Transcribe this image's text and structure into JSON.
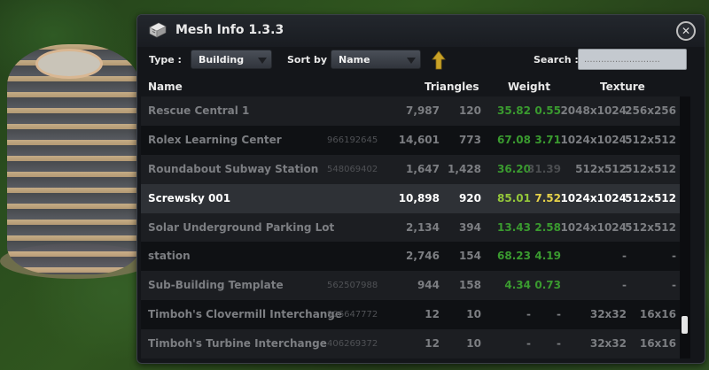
{
  "window": {
    "title": "Mesh Info 1.3.3",
    "close_glyph": "✕",
    "icon": "mesh-info-app-icon"
  },
  "toolbar": {
    "type_label": "Type :",
    "type_value": "Building",
    "sort_label": "Sort by :",
    "sort_value": "Name",
    "sort_direction_icon": "arrow-up-icon",
    "search_label": "Search :",
    "search_value": "",
    "search_placeholder": "..........................."
  },
  "columns": {
    "name": "Name",
    "triangles": "Triangles",
    "weight": "Weight",
    "texture": "Texture"
  },
  "rows": [
    {
      "name": "Rescue Central 1",
      "id": "",
      "triangles": "7,987",
      "lod_triangles": "120",
      "weight": "35.82",
      "lod_weight": "0.55",
      "texture": "2048x1024",
      "lod_texture": "256x256"
    },
    {
      "name": "Rolex Learning Center",
      "id": "966192645",
      "triangles": "14,601",
      "lod_triangles": "773",
      "weight": "67.08",
      "lod_weight": "3.71",
      "texture": "1024x1024",
      "lod_texture": "512x512"
    },
    {
      "name": "Roundabout Subway Station",
      "id": "548069402",
      "triangles": "1,647",
      "lod_triangles": "1,428",
      "weight": "36.20",
      "lod_weight": "31.39",
      "texture": "512x512",
      "lod_texture": "512x512"
    },
    {
      "name": "Screwsky 001",
      "id": "",
      "triangles": "10,898",
      "lod_triangles": "920",
      "weight": "85.01",
      "lod_weight": "7.52",
      "texture": "1024x1024",
      "lod_texture": "512x512"
    },
    {
      "name": "Solar Underground Parking Lot",
      "id": "",
      "triangles": "2,134",
      "lod_triangles": "394",
      "weight": "13.43",
      "lod_weight": "2.58",
      "texture": "1024x1024",
      "lod_texture": "512x512"
    },
    {
      "name": "station",
      "id": "",
      "triangles": "2,746",
      "lod_triangles": "154",
      "weight": "68.23",
      "lod_weight": "4.19",
      "texture": "-",
      "lod_texture": "-"
    },
    {
      "name": "Sub-Building Template",
      "id": "562507988",
      "triangles": "944",
      "lod_triangles": "158",
      "weight": "4.34",
      "lod_weight": "0.73",
      "texture": "-",
      "lod_texture": "-"
    },
    {
      "name": "Timboh's Clovermill Interchange",
      "id": "906647772",
      "triangles": "12",
      "lod_triangles": "10",
      "weight": "-",
      "lod_weight": "-",
      "texture": "32x32",
      "lod_texture": "16x16"
    },
    {
      "name": "Timboh's Turbine Interchange",
      "id": "406269372",
      "triangles": "12",
      "lod_triangles": "10",
      "weight": "-",
      "lod_weight": "-",
      "texture": "32x32",
      "lod_texture": "16x16"
    }
  ],
  "selected_row": "Screwsky 001",
  "colors": {
    "weight_ok": "#3a9a2f",
    "weight_selected": "#94c73a",
    "weight_warning": "#e6d24a",
    "panel_bg": "#14161a",
    "sort_arrow": "#c9a227"
  }
}
